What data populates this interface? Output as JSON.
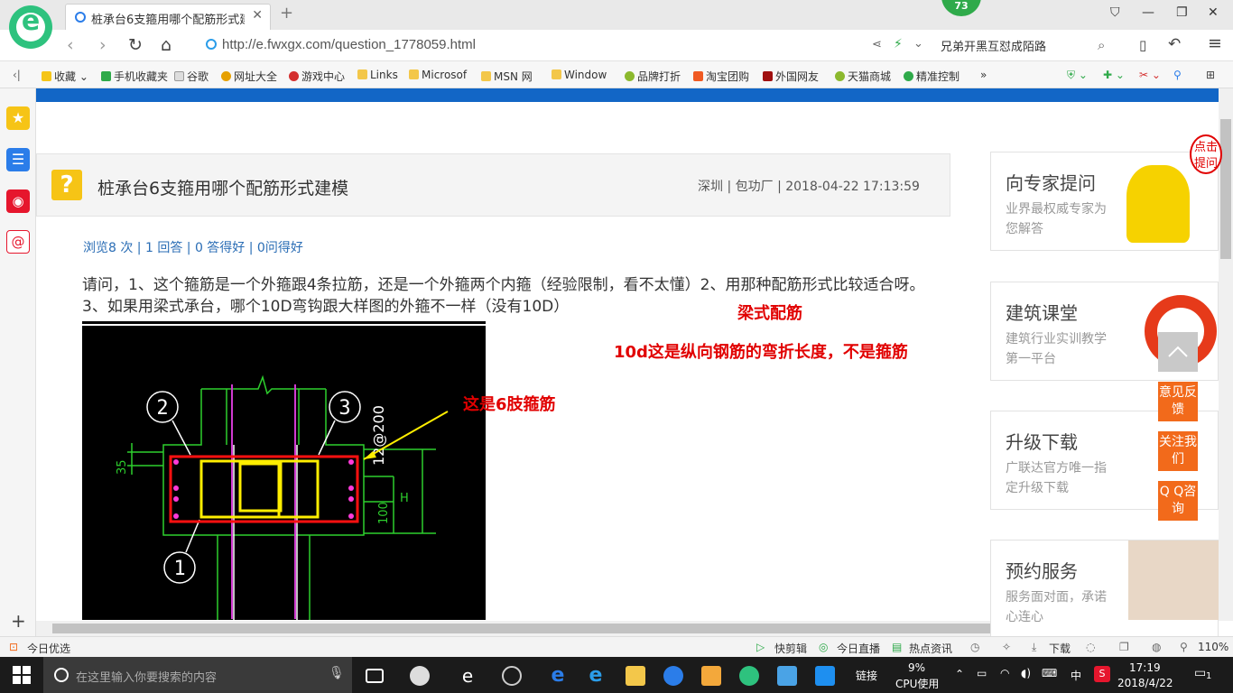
{
  "browser": {
    "tab_title": "桩承台6支箍用哪个配筋形式建模",
    "notification_count": "73",
    "url": "http://e.fwxgx.com/question_1778059.html",
    "search_text": "兄弟开黑互怼成陌路",
    "bookmarks": [
      "收藏",
      "手机收藏夹",
      "谷歌",
      "网址大全",
      "游戏中心",
      "Links",
      "Microsof",
      "MSN 网",
      "Window",
      "品牌打折",
      "淘宝团购",
      "外国网友",
      "天猫商城",
      "精准控制"
    ],
    "more": "»"
  },
  "question": {
    "title": "桩承台6支箍用哪个配筋形式建模",
    "meta": "深圳 | 包功厂 | 2018-04-22 17:13:59",
    "icon": "?",
    "stats": "浏览8 次 | 1 回答 | 0 答得好 | 0问得好",
    "body": "请问，1、这个箍筋是一个外箍跟4条拉筋，还是一个外箍两个内箍（经验限制，看不太懂）2、用那种配筋形式比较适合呀。3、如果用梁式承台，哪个10D弯钩跟大样图的外箍不一样（没有10D）"
  },
  "drawing": {
    "labels": [
      "2",
      "3",
      "1",
      "35",
      "H",
      "100",
      "12@200"
    ]
  },
  "annotations": {
    "beam": "梁式配筋",
    "note_10d": "10d这是纵向钢筋的弯折长度，不是箍筋",
    "six_leg": "这是6肢箍筋"
  },
  "sidebar": {
    "cards": [
      {
        "title": "向专家提问",
        "sub": "业界最权威专家为您解答"
      },
      {
        "title": "建筑课堂",
        "sub": "建筑行业实训教学第一平台"
      },
      {
        "title": "升级下载",
        "sub": "广联达官方唯一指定升级下载"
      },
      {
        "title": "预约服务",
        "sub": "服务面对面，承诺心连心"
      }
    ],
    "bubble": "点击提问",
    "feedback": "意见反馈",
    "follow": "关注我们",
    "qq": "Q Q咨询"
  },
  "statusbar": {
    "today": "今日优选",
    "items": [
      "快剪辑",
      "今日直播",
      "热点资讯",
      "下载"
    ],
    "zoom": "110%"
  },
  "taskbar": {
    "search_placeholder": "在这里输入你要搜索的内容",
    "link": "链接",
    "cpu_pct": "9%",
    "cpu_label": "CPU使用",
    "ime": "中",
    "time": "17:19",
    "date": "2018/4/22",
    "notify": "1"
  }
}
